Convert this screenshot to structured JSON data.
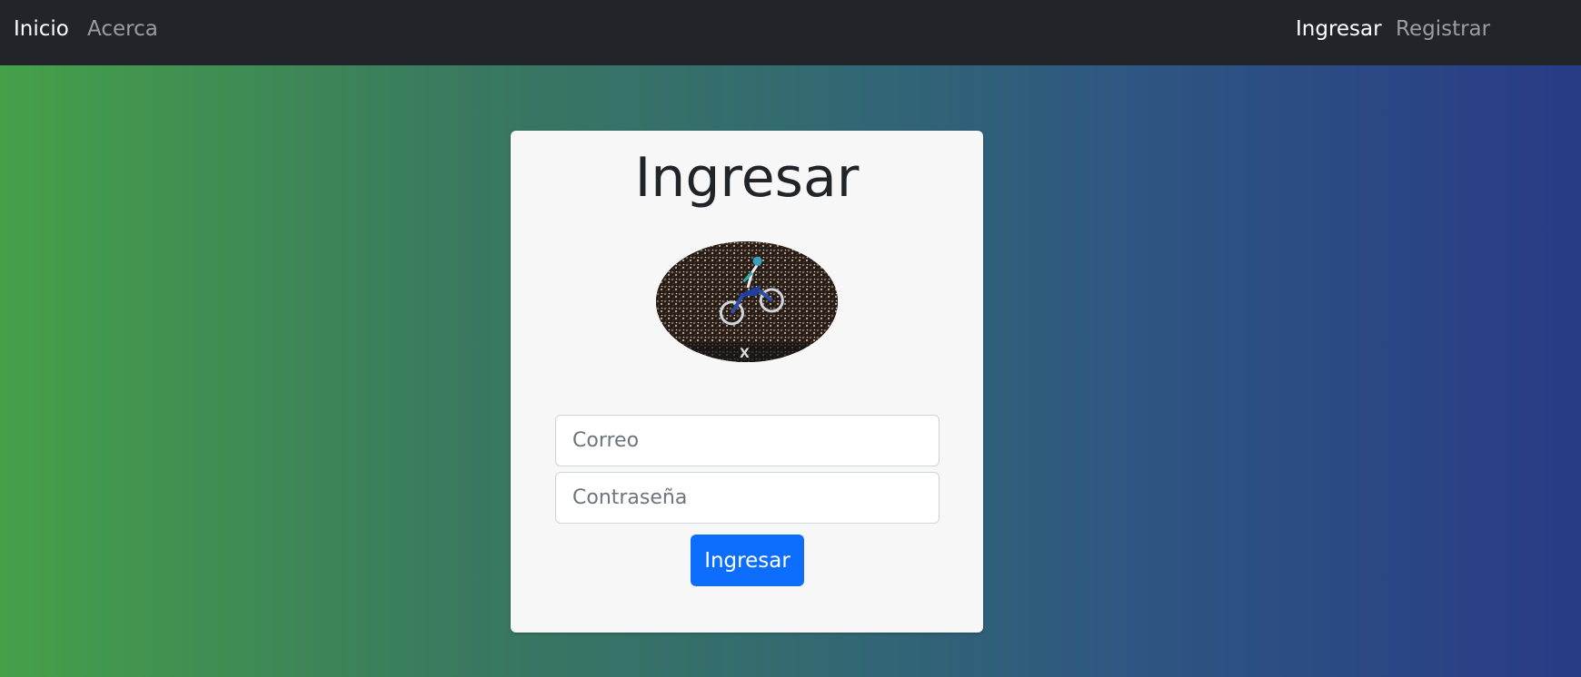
{
  "navbar": {
    "left_links": [
      {
        "label": "Inicio"
      },
      {
        "label": "Acerca"
      }
    ],
    "right_links": [
      {
        "label": "Ingresar"
      },
      {
        "label": "Registrar"
      }
    ]
  },
  "login_card": {
    "title": "Ingresar",
    "email_placeholder": "Correo",
    "password_placeholder": "Contraseña",
    "submit_label": "Ingresar"
  },
  "colors": {
    "navbar_bg": "#212529",
    "primary_button": "#0d6efd",
    "gradient_left": "#45a049",
    "gradient_right": "#283b85"
  }
}
